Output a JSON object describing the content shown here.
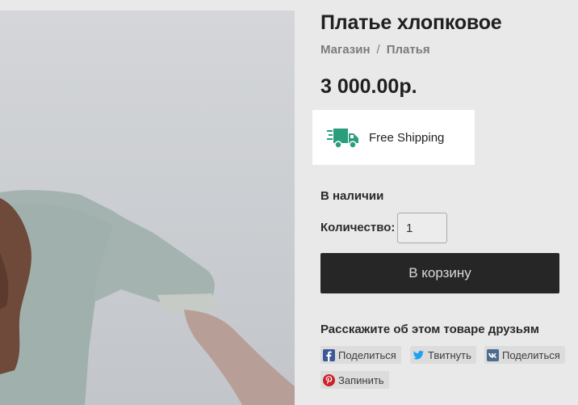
{
  "product": {
    "title": "Платье хлопковое",
    "price": "3 000.00р.",
    "stock_status": "В наличии"
  },
  "breadcrumb": {
    "items": [
      "Магазин",
      "Платья"
    ],
    "separator": "/"
  },
  "shipping": {
    "label": "Free Shipping",
    "icon": "truck-icon",
    "accent_color": "#2a9d7c"
  },
  "quantity": {
    "label": "Количество:",
    "value": "1"
  },
  "cart": {
    "button_label": "В корзину"
  },
  "share": {
    "title": "Расскажите об этом товаре друзьям",
    "buttons": [
      {
        "label": "Поделиться",
        "icon": "facebook-icon",
        "color": "#3b5998"
      },
      {
        "label": "Твитнуть",
        "icon": "twitter-icon",
        "color": "#1da1f2"
      },
      {
        "label": "Поделиться",
        "icon": "vk-icon",
        "color": "#4c6c91"
      },
      {
        "label": "Запинить",
        "icon": "pinterest-icon",
        "color": "#cb2027"
      }
    ]
  },
  "colors": {
    "overlay_background": "#e9e9e9",
    "button_background": "#262626"
  }
}
